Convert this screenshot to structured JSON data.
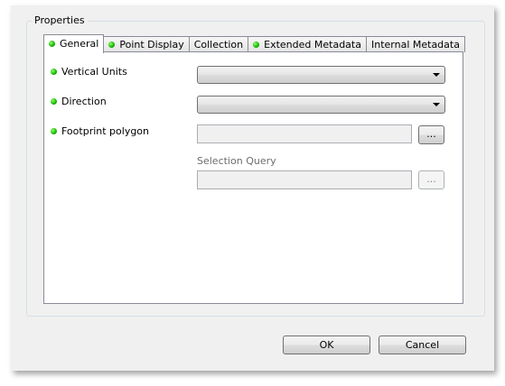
{
  "group": {
    "title": "Properties"
  },
  "tabs": [
    {
      "label": "General",
      "has_indicator": true,
      "active": true
    },
    {
      "label": "Point Display",
      "has_indicator": true,
      "active": false
    },
    {
      "label": "Collection",
      "has_indicator": false,
      "active": false
    },
    {
      "label": "Extended Metadata",
      "has_indicator": true,
      "active": false
    },
    {
      "label": "Internal Metadata",
      "has_indicator": false,
      "active": false
    }
  ],
  "fields": {
    "vertical_units": {
      "label": "Vertical Units",
      "value": ""
    },
    "direction": {
      "label": "Direction",
      "value": ""
    },
    "footprint_polygon": {
      "label": "Footprint polygon",
      "value": "",
      "browse_label": "..."
    },
    "selection_query": {
      "label": "Selection Query",
      "value": "",
      "browse_label": "..."
    }
  },
  "buttons": {
    "ok": "OK",
    "cancel": "Cancel"
  },
  "colors": {
    "indicator": "#14b400",
    "dialog_bg": "#f0f0f0",
    "panel_bg": "#ffffff"
  }
}
